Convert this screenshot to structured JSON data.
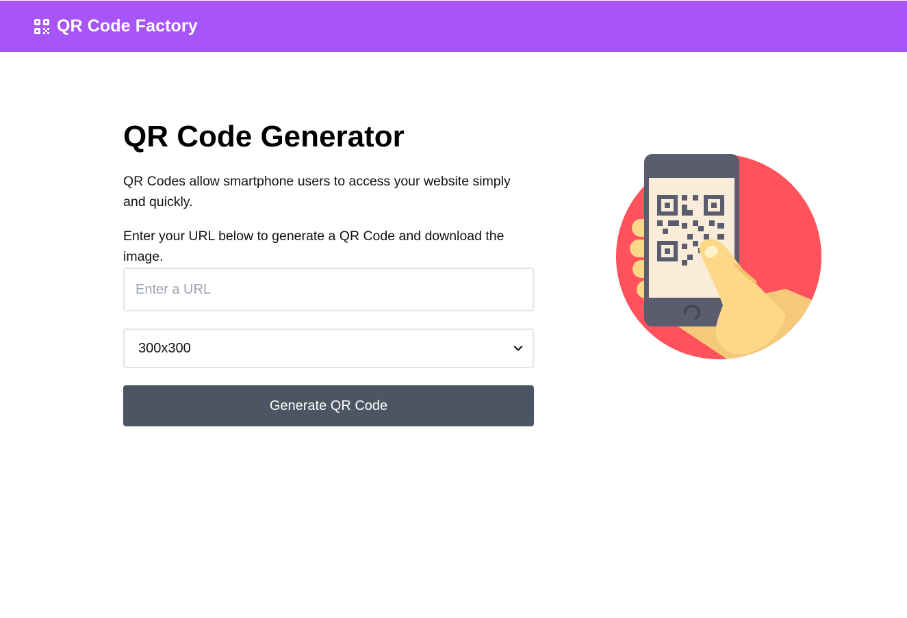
{
  "navbar": {
    "brand_title": "QR Code Factory",
    "brand_icon": "qrcode-icon",
    "background_color": "#a855f7"
  },
  "main": {
    "heading": "QR Code Generator",
    "description": "QR Codes allow smartphone users to access your website simply and quickly.",
    "instruction": "Enter your URL below to generate a QR Code and download the image.",
    "url_input": {
      "value": "",
      "placeholder": "Enter a URL"
    },
    "size_select": {
      "selected": "300x300"
    },
    "generate_button_label": "Generate QR Code",
    "button_color": "#4b5563"
  },
  "illustration": {
    "icon": "phone-scanning-qr-illustration",
    "circle_color": "#ff525d",
    "phone_color": "#5b5d6e",
    "hand_color": "#fdd888"
  }
}
